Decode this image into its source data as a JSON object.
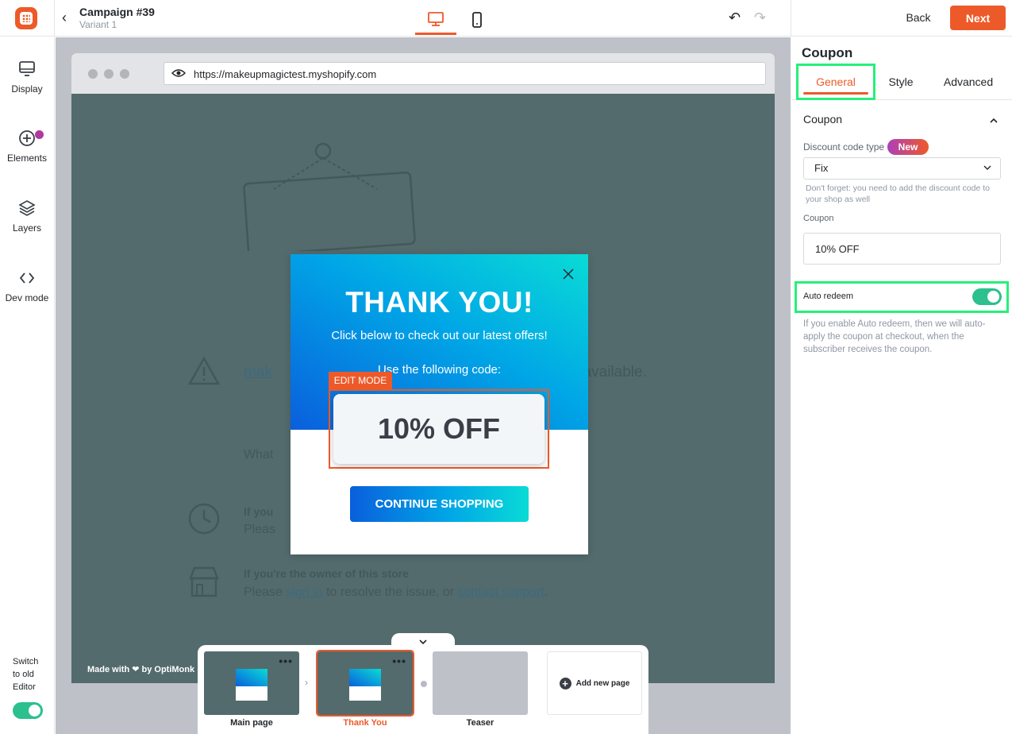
{
  "header": {
    "campaign_title": "Campaign #39",
    "variant": "Variant 1",
    "back_label": "Back",
    "next_label": "Next"
  },
  "sidebar": {
    "items": [
      {
        "label": "Display",
        "icon": "monitor-icon"
      },
      {
        "label": "Elements",
        "icon": "plus-circle-icon"
      },
      {
        "label": "Layers",
        "icon": "layers-icon"
      },
      {
        "label": "Dev mode",
        "icon": "code-icon"
      }
    ],
    "switch_label_1": "Switch",
    "switch_label_2": "to old",
    "switch_label_3": "Editor",
    "switch_on": true
  },
  "browser": {
    "url": "https://makeupmagictest.myshopify.com",
    "made_with": "Made with ❤ by OptiMonk",
    "ghost": {
      "unavailable_link": "mak",
      "unavailable_text": "navailable.",
      "what": "What",
      "if_you": "If you",
      "please_short": "Pleas",
      "owner_heading": "If you're the owner of this store",
      "owner_please": "Please ",
      "sign_in": "sign in",
      "resolve": " to resolve the issue, or ",
      "contact": "contact support",
      "period": "."
    }
  },
  "popup": {
    "title": "THANK YOU!",
    "subtitle": "Click below to check out our latest offers!",
    "code_label": "Use the following code:",
    "edit_mode": "EDIT MODE",
    "coupon": "10% OFF",
    "cta": "CONTINUE SHOPPING"
  },
  "pages": {
    "items": [
      {
        "label": "Main page",
        "active": false
      },
      {
        "label": "Thank You",
        "active": true
      },
      {
        "label": "Teaser",
        "active": false
      }
    ],
    "add_label": "Add new page"
  },
  "panel": {
    "title": "Coupon",
    "tabs": [
      {
        "label": "General",
        "active": true
      },
      {
        "label": "Style",
        "active": false
      },
      {
        "label": "Advanced",
        "active": false
      }
    ],
    "section": "Coupon",
    "discount_type_label": "Discount code type",
    "new_badge": "New",
    "discount_type_value": "Fix",
    "hint": "Don't forget: you need to add the discount code to your shop as well",
    "coupon_label": "Coupon",
    "coupon_value": "10% OFF",
    "auto_redeem_label": "Auto redeem",
    "auto_redeem_on": true,
    "auto_redeem_hint": "If you enable Auto redeem, then we will auto-apply the coupon at checkout, when the subscriber receives the coupon."
  },
  "colors": {
    "accent": "#ed5a29",
    "toggle_on": "#2bc08e",
    "highlight": "#26f07a",
    "popup_gradient_start": "#0a5fdc",
    "popup_gradient_end": "#0adbd6"
  }
}
